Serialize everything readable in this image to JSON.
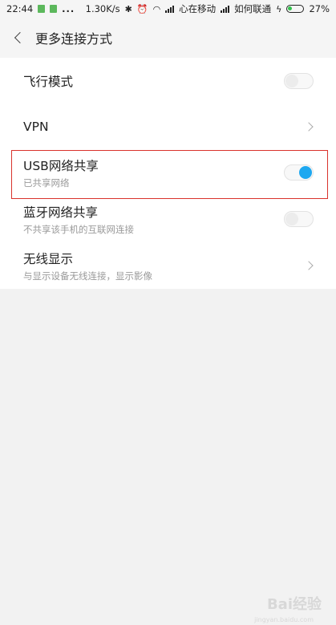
{
  "status_bar": {
    "time": "22:44",
    "dots": "...",
    "speed": "1.30K/s",
    "carrier1": "心在移动",
    "carrier2": "如何联通",
    "battery_pct": "27%",
    "battery_level": 0.27
  },
  "header": {
    "title": "更多连接方式"
  },
  "rows": [
    {
      "label": "飞行模式",
      "sub": "",
      "control": "toggle",
      "on": false
    },
    {
      "label": "VPN",
      "sub": "",
      "control": "chevron"
    },
    {
      "label": "USB网络共享",
      "sub": "已共享网络",
      "control": "toggle",
      "on": true
    },
    {
      "label": "蓝牙网络共享",
      "sub": "不共享该手机的互联网连接",
      "control": "toggle",
      "on": false
    },
    {
      "label": "无线显示",
      "sub": "与显示设备无线连接，显示影像",
      "control": "chevron"
    }
  ],
  "watermark": {
    "text": "Bai经验",
    "sub": "jingyan.baidu.com"
  },
  "colors": {
    "toggle_on": "#1ea8f0",
    "highlight": "#d9322c",
    "battery": "#33c24d"
  }
}
